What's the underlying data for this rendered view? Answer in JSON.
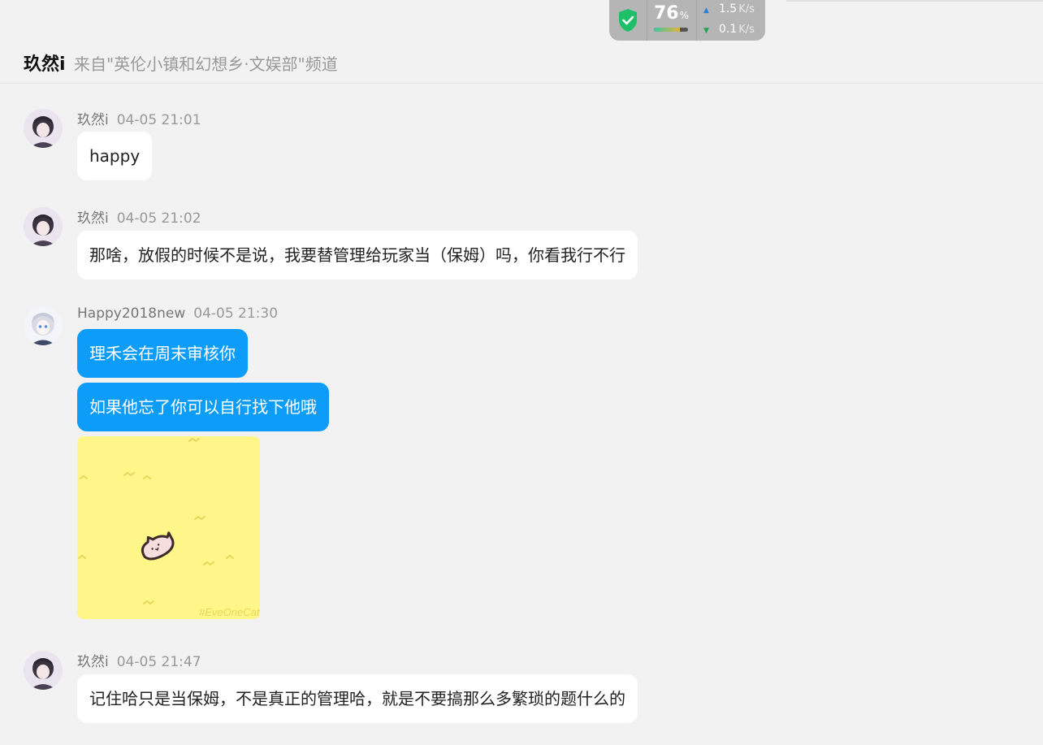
{
  "netmon": {
    "percent": "76",
    "percent_unit": "%",
    "cpu_level": 0.76,
    "upload": "1.5",
    "download": "0.1",
    "unit": "K/s"
  },
  "header": {
    "name": "玖然i",
    "origin": "来自\"英伦小镇和幻想乡·文娱部\"频道"
  },
  "messages": [
    {
      "author": "玖然i",
      "time": "04-05 21:01",
      "text": "happy"
    },
    {
      "author": "玖然i",
      "time": "04-05 21:02",
      "text": "那啥，放假的时候不是说，我要替管理给玩家当（保姆）吗，你看我行不行"
    },
    {
      "author": "Happy2018new",
      "time": "04-05 21:30",
      "texts": [
        "理禾会在周末审核你",
        "如果他忘了你可以自行找下他哦"
      ],
      "sticker_caption": "#EveOneCat"
    },
    {
      "author": "玖然i",
      "time": "04-05 21:47",
      "text": "记住哈只是当保姆，不是真正的管理哈，就是不要搞那么多繁琐的题什么的"
    }
  ]
}
